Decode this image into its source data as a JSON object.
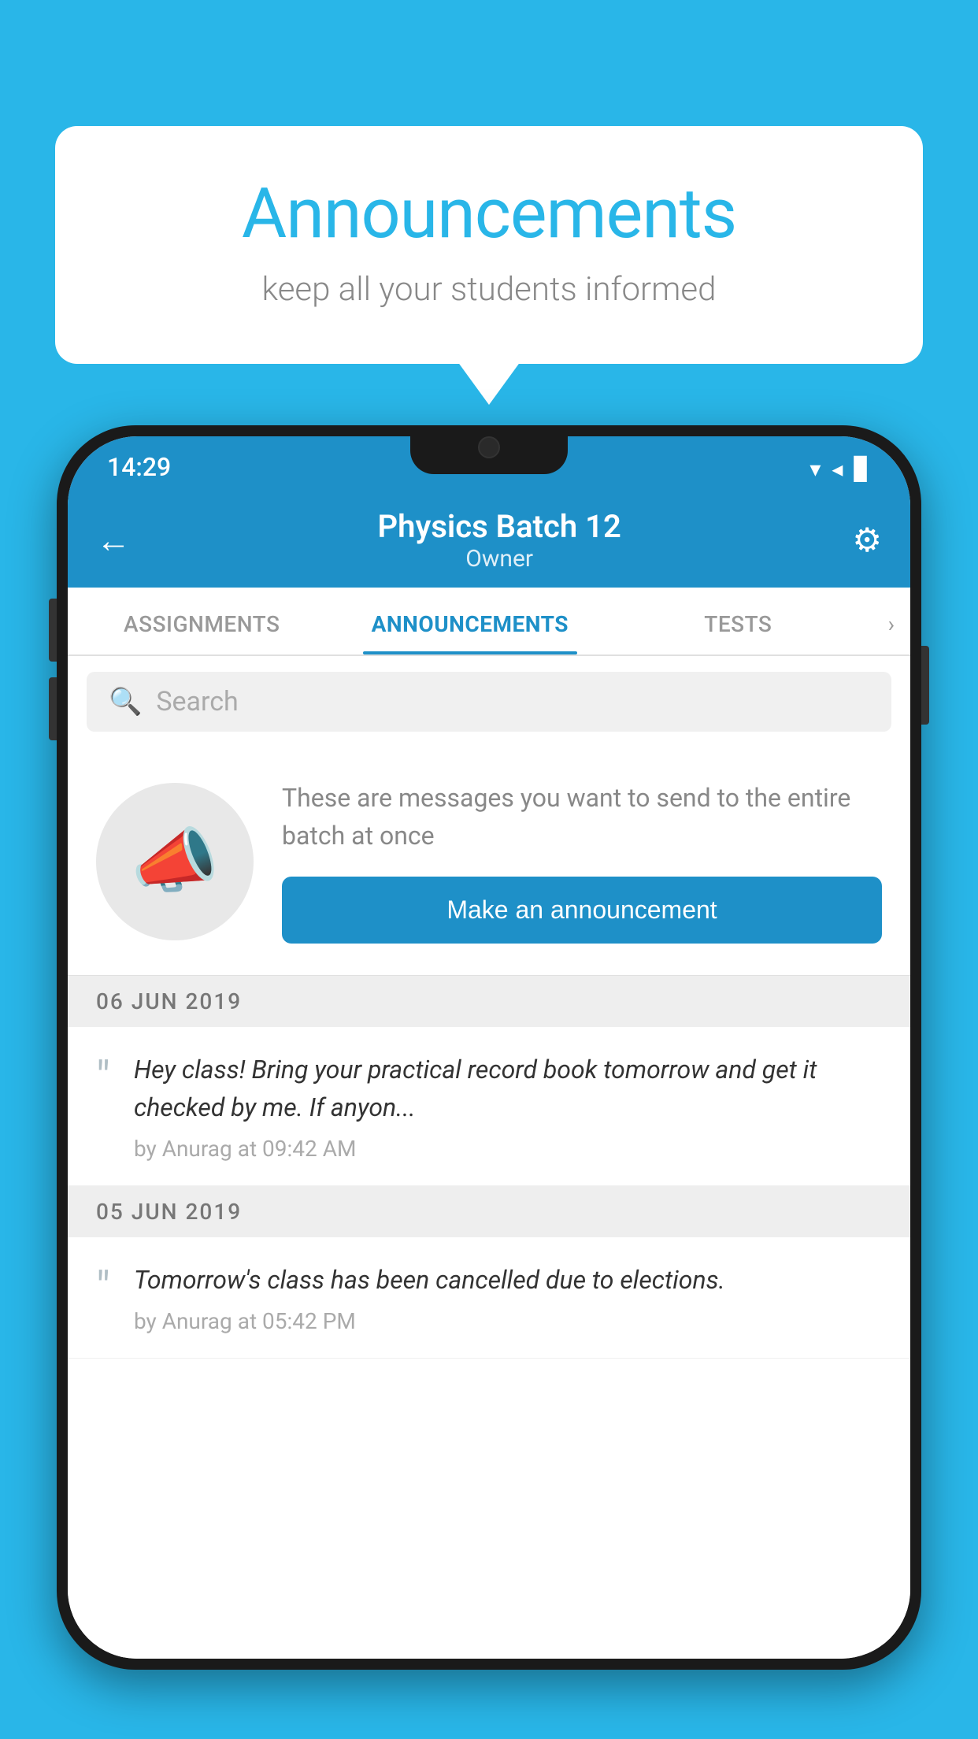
{
  "background_color": "#29b6e8",
  "speech_bubble": {
    "title": "Announcements",
    "subtitle": "keep all your students informed"
  },
  "status_bar": {
    "time": "14:29",
    "wifi": "▲",
    "signal": "▲",
    "battery": "▊"
  },
  "header": {
    "title": "Physics Batch 12",
    "subtitle": "Owner",
    "back_label": "←",
    "settings_label": "⚙"
  },
  "tabs": [
    {
      "label": "ASSIGNMENTS",
      "active": false
    },
    {
      "label": "ANNOUNCEMENTS",
      "active": true
    },
    {
      "label": "TESTS",
      "active": false
    }
  ],
  "search": {
    "placeholder": "Search"
  },
  "cta": {
    "description": "These are messages you want to send to the entire batch at once",
    "button_label": "Make an announcement"
  },
  "announcements": [
    {
      "date": "06  JUN  2019",
      "text": "Hey class! Bring your practical record book tomorrow and get it checked by me. If anyon...",
      "meta": "by Anurag at 09:42 AM"
    },
    {
      "date": "05  JUN  2019",
      "text": "Tomorrow's class has been cancelled due to elections.",
      "meta": "by Anurag at 05:42 PM"
    }
  ]
}
